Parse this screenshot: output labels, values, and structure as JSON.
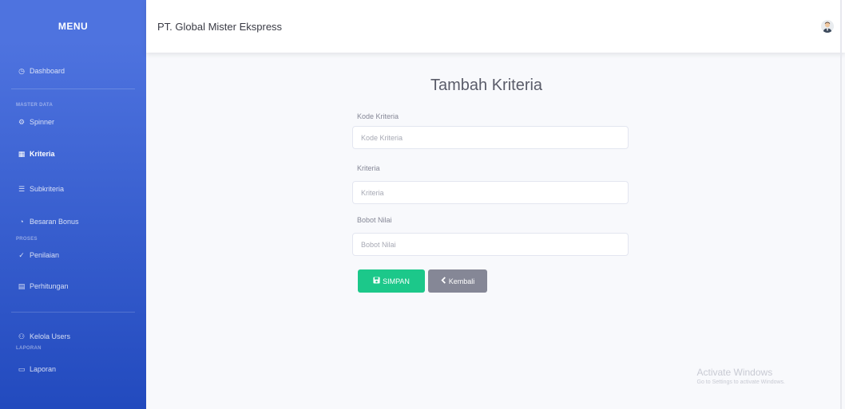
{
  "sidebar": {
    "brand": "MENU",
    "items": [
      {
        "label": "Dashboard",
        "icon": "gauge-icon",
        "glyph": "◷"
      },
      {
        "label": "Spinner",
        "icon": "spinner-icon",
        "glyph": "⚙"
      },
      {
        "label": "Kriteria",
        "icon": "table-icon",
        "glyph": "▦"
      },
      {
        "label": "Subkriteria",
        "icon": "list-icon",
        "glyph": "☰"
      },
      {
        "label": "Besaran Bonus",
        "icon": "chart-icon",
        "glyph": "◔"
      },
      {
        "label": "Penilaian",
        "icon": "check-icon",
        "glyph": "✓"
      },
      {
        "label": "Perhitungan",
        "icon": "calculator-icon",
        "glyph": "▤"
      },
      {
        "label": "Kelola Users",
        "icon": "users-icon",
        "glyph": "⚇"
      },
      {
        "label": "Laporan",
        "icon": "report-icon",
        "glyph": "▭"
      }
    ],
    "headings": [
      "MASTER DATA",
      "PROSES",
      "LAPORAN"
    ]
  },
  "topbar": {
    "company": "PT. Global Mister Ekspress"
  },
  "form": {
    "title": "Tambah Kriteria",
    "kode_label": "Kode Kriteria",
    "kode_placeholder": "Kode Kriteria",
    "kriteria_label": "Kriteria",
    "kriteria_placeholder": "Kriteria",
    "bobot_label": "Bobot Nilai",
    "bobot_placeholder": "Bobot Nilai",
    "save_label": "SIMPAN",
    "back_label": "Kembali"
  },
  "watermark": {
    "title": "Activate Windows",
    "subtitle": "Go to Settings to activate Windows."
  },
  "colors": {
    "sidebar": "#4e73df",
    "success": "#1cc88a",
    "secondary": "#858796"
  }
}
